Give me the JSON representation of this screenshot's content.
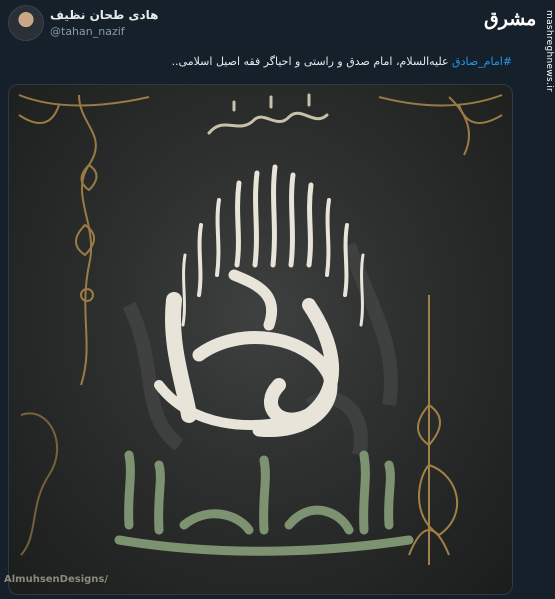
{
  "tweet": {
    "author_name": "هادی طحان نظیف",
    "author_handle": "@tahan_nazif",
    "hashtag": "#امام_صادق",
    "text": " علیه‌السلام، امام صدق و راستی و احیاگر فقه اصیل اسلامی.."
  },
  "brand": {
    "logo": "مشرق",
    "side_url": "mashreghnews.ir"
  },
  "media": {
    "watermark": "AlmuhsenDesigns/"
  },
  "colors": {
    "background": "#15202b",
    "link": "#1d9bf0",
    "gold": "#b08a4a",
    "green_text": "#7d9270"
  }
}
